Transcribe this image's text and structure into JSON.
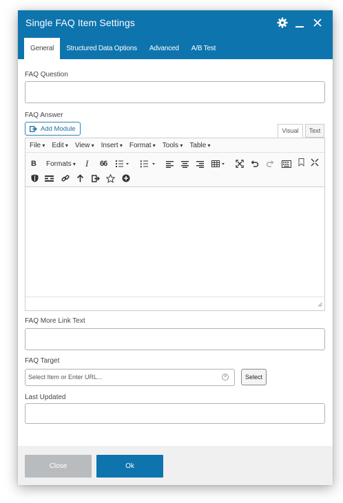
{
  "dialog": {
    "title": "Single FAQ Item Settings",
    "icons": [
      "gear-icon",
      "minimize-icon",
      "close-icon"
    ]
  },
  "tabs": [
    {
      "label": "General",
      "active": true
    },
    {
      "label": "Structured Data Options",
      "active": false
    },
    {
      "label": "Advanced",
      "active": false
    },
    {
      "label": "A/B Test",
      "active": false
    }
  ],
  "form": {
    "faq_question_label": "FAQ Question",
    "faq_question_value": "",
    "faq_answer_label": "FAQ Answer",
    "add_module_label": "Add Module",
    "editor_mode_visual": "Visual",
    "editor_mode_text": "Text",
    "faq_more_link_label": "FAQ More Link Text",
    "faq_more_link_value": "",
    "faq_target_label": "FAQ Target",
    "faq_target_placeholder": "Select Item or Enter URL...",
    "select_button_label": "Select",
    "last_updated_label": "Last Updated",
    "last_updated_value": ""
  },
  "editor": {
    "menu": [
      "File",
      "Edit",
      "View",
      "Insert",
      "Format",
      "Tools",
      "Table"
    ],
    "formats_label": "Formats",
    "bold_glyph": "B",
    "italic_glyph": "I",
    "quote_glyph": "66"
  },
  "footer": {
    "close_label": "Close",
    "ok_label": "Ok"
  },
  "colors": {
    "header": "#0e74ad",
    "primary_button": "#0e74ad",
    "disabled_button": "#b9bcbf"
  }
}
